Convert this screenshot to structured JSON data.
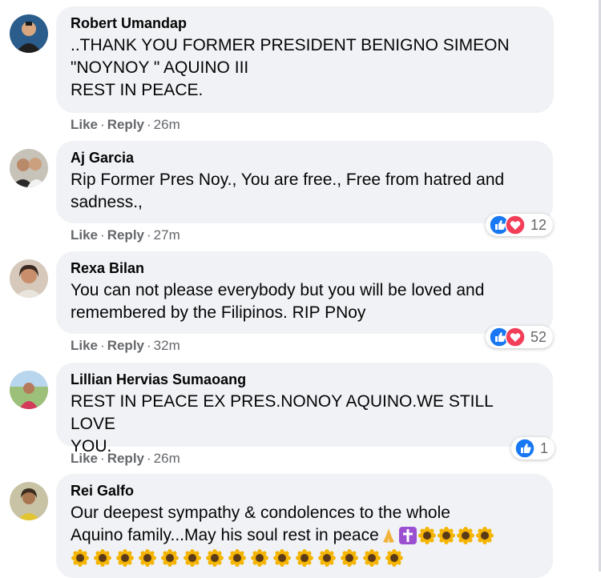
{
  "colors": {
    "bubble": "#f0f2f5",
    "meta_text": "#65676b",
    "like_blue": "#1877f2",
    "love_red": "#f33e58"
  },
  "actions": {
    "like": "Like",
    "reply": "Reply",
    "separator": "·"
  },
  "comments": [
    {
      "author": "Robert Umandap",
      "text": "..THANK YOU FORMER PRESIDENT BENIGNO SIMEON\n\"NOYNOY \" AQUINO III\nREST IN PEACE.",
      "time": "26m"
    },
    {
      "author": "Aj Garcia",
      "text": "Rip Former Pres Noy., You are free., Free from hatred and\nsadness.,",
      "time": "27m",
      "reactions": {
        "icons": [
          "like-icon",
          "love-icon"
        ],
        "count": "12"
      }
    },
    {
      "author": "Rexa Bilan",
      "text": "You can not please everybody but you will be loved and\nremembered by the Filipinos. RIP PNoy",
      "time": "32m",
      "reactions": {
        "icons": [
          "like-icon",
          "love-icon"
        ],
        "count": "52"
      }
    },
    {
      "author": "Lillian Hervias Sumaoang",
      "text": "REST IN PEACE EX PRES.NONOY AQUINO.WE STILL LOVE\nYOU.",
      "time": "26m",
      "reactions": {
        "icons": [
          "like-icon"
        ],
        "count": "1"
      }
    },
    {
      "author": "Rei Galfo",
      "text": "Our deepest sympathy & condolences to the whole\nAquino family...May his soul rest in peace",
      "emoji_inline": [
        "folded-hands-icon",
        "cross-icon",
        "sunflower-icon",
        "sunflower-icon",
        "sunflower-icon",
        "sunflower-icon"
      ],
      "emoji_row_count": 15
    }
  ]
}
